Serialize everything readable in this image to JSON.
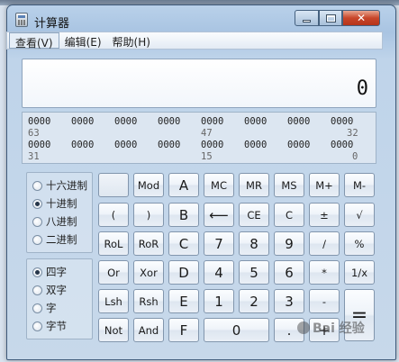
{
  "window": {
    "title": "计算器"
  },
  "menu": {
    "view": "查看(V)",
    "edit": "编辑(E)",
    "help": "帮助(H)"
  },
  "display": {
    "value": "0"
  },
  "bits": {
    "row1": [
      "0000",
      "0000",
      "0000",
      "0000",
      "0000",
      "0000",
      "0000",
      "0000"
    ],
    "row1_idx": [
      "63",
      "47",
      "32"
    ],
    "row2": [
      "0000",
      "0000",
      "0000",
      "0000",
      "0000",
      "0000",
      "0000",
      "0000"
    ],
    "row2_idx": [
      "31",
      "15",
      "0"
    ]
  },
  "base": {
    "hex": "十六进制",
    "dec": "十进制",
    "oct": "八进制",
    "bin": "二进制",
    "selected": "十进制"
  },
  "word": {
    "qword": "四字",
    "dword": "双字",
    "word": "字",
    "byte": "字节",
    "selected": "四字"
  },
  "keys": {
    "mod": "Mod",
    "a": "A",
    "mc": "MC",
    "mr": "MR",
    "ms": "MS",
    "mplus": "M+",
    "mminus": "M-",
    "lparen": "(",
    "rparen": ")",
    "b": "B",
    "backspace": "⟵",
    "ce": "CE",
    "c": "C",
    "plusminus": "±",
    "sqrt": "√",
    "rol": "RoL",
    "ror": "RoR",
    "cc": "C",
    "n7": "7",
    "n8": "8",
    "n9": "9",
    "div": "/",
    "pct": "%",
    "or": "Or",
    "xor": "Xor",
    "d": "D",
    "n4": "4",
    "n5": "5",
    "n6": "6",
    "mul": "*",
    "recip": "1/x",
    "lsh": "Lsh",
    "rsh": "Rsh",
    "e": "E",
    "n1": "1",
    "n2": "2",
    "n3": "3",
    "minus": "-",
    "equals": "=",
    "not": "Not",
    "and": "And",
    "f": "F",
    "n0": "0",
    "dot": ".",
    "plus": "+"
  },
  "watermark": "Bai 经验"
}
